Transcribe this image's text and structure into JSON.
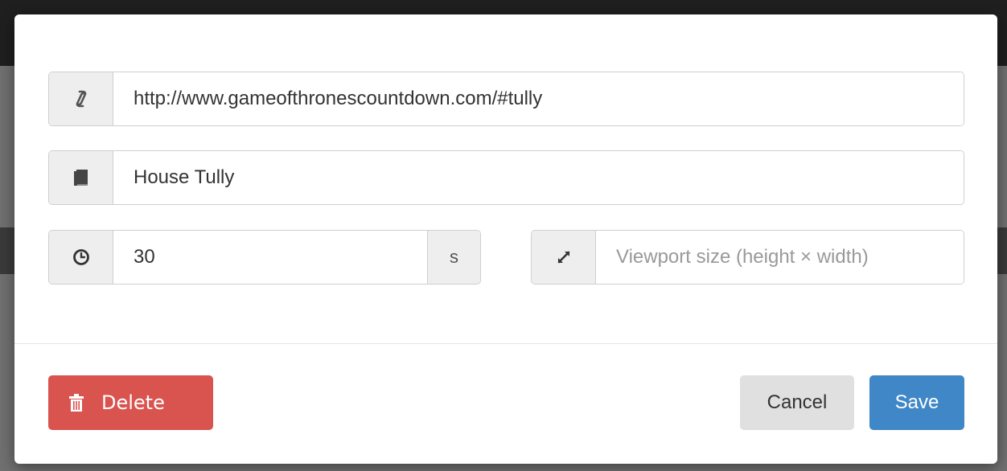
{
  "form": {
    "url": {
      "icon": "link-icon",
      "value": "http://www.gameofthronescountdown.com/#tully",
      "placeholder": ""
    },
    "title": {
      "icon": "book-icon",
      "value": "House Tully",
      "placeholder": ""
    },
    "duration": {
      "icon": "clock-icon",
      "value": "30",
      "unit": "s"
    },
    "viewport": {
      "icon": "resize-icon",
      "value": "",
      "placeholder": "Viewport size (height × width)"
    }
  },
  "footer": {
    "delete_label": "Delete",
    "delete_icon": "trash-icon",
    "cancel_label": "Cancel",
    "save_label": "Save"
  },
  "colors": {
    "danger": "#d9534f",
    "primary": "#3f87c7",
    "default": "#e0e0e0",
    "addon": "#eeeeee"
  }
}
